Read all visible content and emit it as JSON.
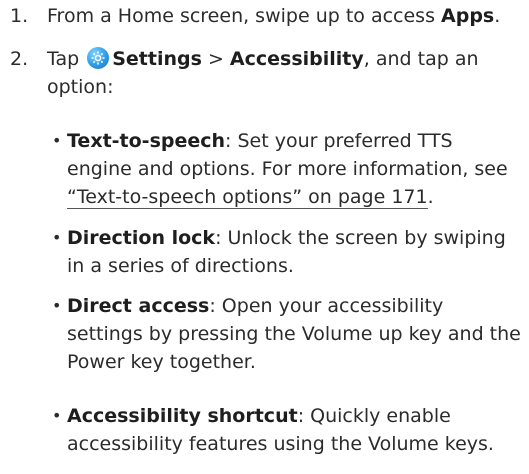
{
  "steps": [
    {
      "number": "1.",
      "text_before": "From a Home screen, swipe up to access ",
      "bold": "Apps",
      "text_after": "."
    },
    {
      "number": "2.",
      "text_before": "Tap ",
      "icon": "settings-gear-icon",
      "bold_settings": "Settings",
      "separator": " > ",
      "bold_accessibility": "Accessibility",
      "text_after": ", and tap an option:"
    }
  ],
  "options": [
    {
      "title": "Text-to-speech",
      "description": ": Set your preferred TTS engine and options. For more information, see ",
      "link": "“Text-to-speech options” on page 171",
      "after_link": "."
    },
    {
      "title": "Direction lock",
      "description": ": Unlock the screen by swiping in a series of directions."
    },
    {
      "title": "Direct access",
      "description": ": Open your accessibility settings by pressing the Volume up key and the Power key together."
    },
    {
      "title": "Accessibility shortcut",
      "description": ": Quickly enable accessibility features using the Volume keys."
    }
  ],
  "colors": {
    "text": "#2b2b2b",
    "icon": "#2e9be6"
  }
}
